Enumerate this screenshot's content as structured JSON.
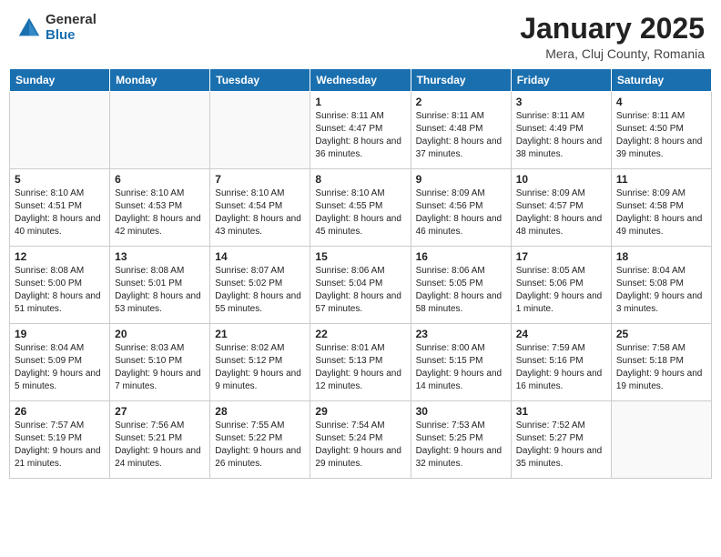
{
  "header": {
    "logo_general": "General",
    "logo_blue": "Blue",
    "month_title": "January 2025",
    "location": "Mera, Cluj County, Romania"
  },
  "weekdays": [
    "Sunday",
    "Monday",
    "Tuesday",
    "Wednesday",
    "Thursday",
    "Friday",
    "Saturday"
  ],
  "weeks": [
    [
      {
        "day": "",
        "info": ""
      },
      {
        "day": "",
        "info": ""
      },
      {
        "day": "",
        "info": ""
      },
      {
        "day": "1",
        "info": "Sunrise: 8:11 AM\nSunset: 4:47 PM\nDaylight: 8 hours and 36 minutes."
      },
      {
        "day": "2",
        "info": "Sunrise: 8:11 AM\nSunset: 4:48 PM\nDaylight: 8 hours and 37 minutes."
      },
      {
        "day": "3",
        "info": "Sunrise: 8:11 AM\nSunset: 4:49 PM\nDaylight: 8 hours and 38 minutes."
      },
      {
        "day": "4",
        "info": "Sunrise: 8:11 AM\nSunset: 4:50 PM\nDaylight: 8 hours and 39 minutes."
      }
    ],
    [
      {
        "day": "5",
        "info": "Sunrise: 8:10 AM\nSunset: 4:51 PM\nDaylight: 8 hours and 40 minutes."
      },
      {
        "day": "6",
        "info": "Sunrise: 8:10 AM\nSunset: 4:53 PM\nDaylight: 8 hours and 42 minutes."
      },
      {
        "day": "7",
        "info": "Sunrise: 8:10 AM\nSunset: 4:54 PM\nDaylight: 8 hours and 43 minutes."
      },
      {
        "day": "8",
        "info": "Sunrise: 8:10 AM\nSunset: 4:55 PM\nDaylight: 8 hours and 45 minutes."
      },
      {
        "day": "9",
        "info": "Sunrise: 8:09 AM\nSunset: 4:56 PM\nDaylight: 8 hours and 46 minutes."
      },
      {
        "day": "10",
        "info": "Sunrise: 8:09 AM\nSunset: 4:57 PM\nDaylight: 8 hours and 48 minutes."
      },
      {
        "day": "11",
        "info": "Sunrise: 8:09 AM\nSunset: 4:58 PM\nDaylight: 8 hours and 49 minutes."
      }
    ],
    [
      {
        "day": "12",
        "info": "Sunrise: 8:08 AM\nSunset: 5:00 PM\nDaylight: 8 hours and 51 minutes."
      },
      {
        "day": "13",
        "info": "Sunrise: 8:08 AM\nSunset: 5:01 PM\nDaylight: 8 hours and 53 minutes."
      },
      {
        "day": "14",
        "info": "Sunrise: 8:07 AM\nSunset: 5:02 PM\nDaylight: 8 hours and 55 minutes."
      },
      {
        "day": "15",
        "info": "Sunrise: 8:06 AM\nSunset: 5:04 PM\nDaylight: 8 hours and 57 minutes."
      },
      {
        "day": "16",
        "info": "Sunrise: 8:06 AM\nSunset: 5:05 PM\nDaylight: 8 hours and 58 minutes."
      },
      {
        "day": "17",
        "info": "Sunrise: 8:05 AM\nSunset: 5:06 PM\nDaylight: 9 hours and 1 minute."
      },
      {
        "day": "18",
        "info": "Sunrise: 8:04 AM\nSunset: 5:08 PM\nDaylight: 9 hours and 3 minutes."
      }
    ],
    [
      {
        "day": "19",
        "info": "Sunrise: 8:04 AM\nSunset: 5:09 PM\nDaylight: 9 hours and 5 minutes."
      },
      {
        "day": "20",
        "info": "Sunrise: 8:03 AM\nSunset: 5:10 PM\nDaylight: 9 hours and 7 minutes."
      },
      {
        "day": "21",
        "info": "Sunrise: 8:02 AM\nSunset: 5:12 PM\nDaylight: 9 hours and 9 minutes."
      },
      {
        "day": "22",
        "info": "Sunrise: 8:01 AM\nSunset: 5:13 PM\nDaylight: 9 hours and 12 minutes."
      },
      {
        "day": "23",
        "info": "Sunrise: 8:00 AM\nSunset: 5:15 PM\nDaylight: 9 hours and 14 minutes."
      },
      {
        "day": "24",
        "info": "Sunrise: 7:59 AM\nSunset: 5:16 PM\nDaylight: 9 hours and 16 minutes."
      },
      {
        "day": "25",
        "info": "Sunrise: 7:58 AM\nSunset: 5:18 PM\nDaylight: 9 hours and 19 minutes."
      }
    ],
    [
      {
        "day": "26",
        "info": "Sunrise: 7:57 AM\nSunset: 5:19 PM\nDaylight: 9 hours and 21 minutes."
      },
      {
        "day": "27",
        "info": "Sunrise: 7:56 AM\nSunset: 5:21 PM\nDaylight: 9 hours and 24 minutes."
      },
      {
        "day": "28",
        "info": "Sunrise: 7:55 AM\nSunset: 5:22 PM\nDaylight: 9 hours and 26 minutes."
      },
      {
        "day": "29",
        "info": "Sunrise: 7:54 AM\nSunset: 5:24 PM\nDaylight: 9 hours and 29 minutes."
      },
      {
        "day": "30",
        "info": "Sunrise: 7:53 AM\nSunset: 5:25 PM\nDaylight: 9 hours and 32 minutes."
      },
      {
        "day": "31",
        "info": "Sunrise: 7:52 AM\nSunset: 5:27 PM\nDaylight: 9 hours and 35 minutes."
      },
      {
        "day": "",
        "info": ""
      }
    ]
  ]
}
